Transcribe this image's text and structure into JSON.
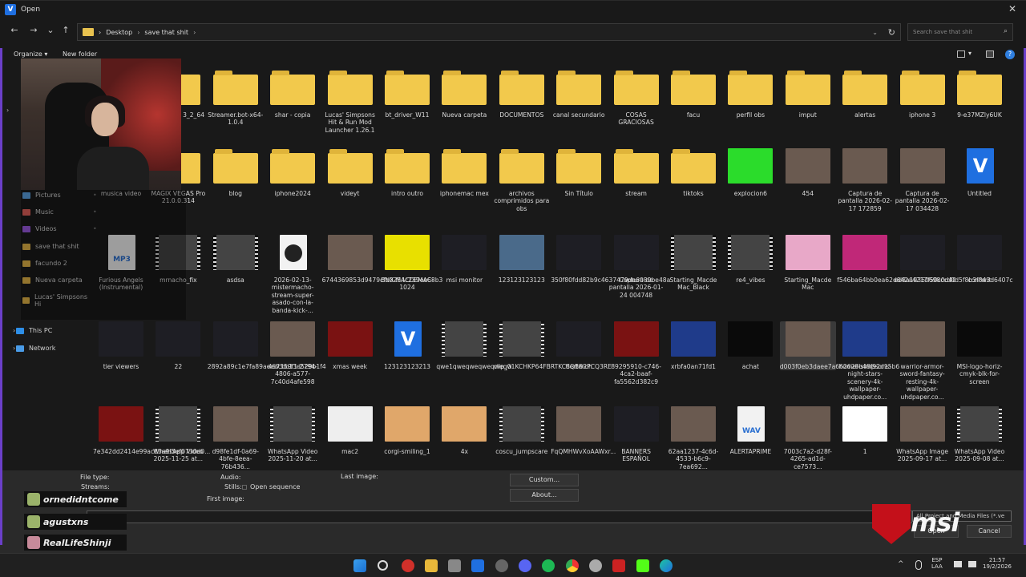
{
  "window": {
    "title": "Open",
    "app_icon": "V",
    "close": "✕"
  },
  "nav": {
    "back": "←",
    "forward": "→",
    "dropdown": "⌄",
    "up": "↑",
    "crumbs": [
      "Desktop",
      "save that shit"
    ],
    "sep": "›",
    "refresh": "↻",
    "addr_dropdown": "⌄",
    "search_placeholder": "Search save that shit",
    "search_icon": "⌕"
  },
  "cmd": {
    "organize": "Organize ▾",
    "new_folder": "New folder",
    "help": "?"
  },
  "sidebar": {
    "items": [
      {
        "label": "Pictures",
        "pin": true
      },
      {
        "label": "Music",
        "pin": true
      },
      {
        "label": "Videos",
        "pin": true
      },
      {
        "label": "save that shit",
        "pin": false
      },
      {
        "label": "facundo 2",
        "pin": false
      },
      {
        "label": "Nueva carpeta",
        "pin": false
      },
      {
        "label": "Lucas' Simpsons Hi",
        "pin": false
      }
    ],
    "this_pc": "This PC",
    "network": "Network"
  },
  "files": [
    {
      "name": "_live_trial 3_2_64",
      "t": "folder"
    },
    {
      "name": "Streamer.bot-x64-1.0.4",
      "t": "folder"
    },
    {
      "name": "shar - copia",
      "t": "folder"
    },
    {
      "name": "Lucas' Simpsons Hit & Run Mod Launcher 1.26.1",
      "t": "folder"
    },
    {
      "name": "bt_driver_W11",
      "t": "folder"
    },
    {
      "name": "Nueva carpeta",
      "t": "folder"
    },
    {
      "name": "DOCUMENTOS",
      "t": "folder"
    },
    {
      "name": "canal secundario",
      "t": "folder"
    },
    {
      "name": "COSAS GRACIOSAS",
      "t": "folder"
    },
    {
      "name": "facu",
      "t": "folder"
    },
    {
      "name": "perfil obs",
      "t": "folder"
    },
    {
      "name": "imput",
      "t": "folder"
    },
    {
      "name": "alertas",
      "t": "folder"
    },
    {
      "name": "iphone 3",
      "t": "folder"
    },
    {
      "name": "9-e37MZly6UK",
      "t": "folder"
    },
    {
      "name": "musica video",
      "t": "folder"
    },
    {
      "name": "MAGIX VEGAS Pro 21.0.0.314",
      "t": "folder"
    },
    {
      "name": "blog",
      "t": "folder"
    },
    {
      "name": "iphone2024",
      "t": "folder"
    },
    {
      "name": "videyt",
      "t": "folder"
    },
    {
      "name": "intro outro",
      "t": "folder"
    },
    {
      "name": "iphonemac mex",
      "t": "folder"
    },
    {
      "name": "archivos comprimidos para obs",
      "t": "folder"
    },
    {
      "name": "Sin Título",
      "t": "folder"
    },
    {
      "name": "stream",
      "t": "folder"
    },
    {
      "name": "tiktoks",
      "t": "folder"
    },
    {
      "name": "explocion6",
      "t": "green"
    },
    {
      "name": "454",
      "t": "photo"
    },
    {
      "name": "Captura de pantalla 2026-02-17 172859",
      "t": "photo"
    },
    {
      "name": "Captura de pantalla 2026-02-17 034428",
      "t": "photo"
    },
    {
      "name": "Untitled",
      "t": "vegas"
    },
    {
      "name": "Furious Angels (Instrumental)",
      "t": "mp3"
    },
    {
      "name": "mrnacho_fix",
      "t": "video"
    },
    {
      "name": "asdsa",
      "t": "video"
    },
    {
      "name": "2026-02-13-mistermacho-stream-super-asado-con-la-banda-kick-...",
      "t": "play"
    },
    {
      "name": "6744369853d9479cfb0254c239ee68b3",
      "t": "photo"
    },
    {
      "name": "BNX-MACDEMAC-1024",
      "t": "qr"
    },
    {
      "name": "msi monitor",
      "t": "dark"
    },
    {
      "name": "123123123123",
      "t": "glitch"
    },
    {
      "name": "350f80fdd82b9c4637479de6080be48a",
      "t": "dark"
    },
    {
      "name": "Captura de pantalla 2026-01-24 004748",
      "t": "dark"
    },
    {
      "name": "Starting_Macde Mac_Black",
      "t": "video"
    },
    {
      "name": "re4_vibes",
      "t": "video"
    },
    {
      "name": "Starting_Macde Mac",
      "t": "pink"
    },
    {
      "name": "f546ba64bb0ea62d842a4217f50c0d40",
      "t": "purple"
    },
    {
      "name": "ed8a19360698ccd0d5f8b3f843d6407c",
      "t": "dark"
    },
    {
      "name": "content",
      "t": "dark"
    },
    {
      "name": "tier viewers",
      "t": "dark"
    },
    {
      "name": "22",
      "t": "dark"
    },
    {
      "name": "2892a89c1e7fa89aeedcbb13d529b1f4",
      "t": "dark"
    },
    {
      "name": "467359f1-2794-4806-a577-7c40d4afe598",
      "t": "photo"
    },
    {
      "name": "xmas week",
      "t": "red"
    },
    {
      "name": "123123123213",
      "t": "vegas"
    },
    {
      "name": "qwe1qweqweqweqweqw",
      "t": "video"
    },
    {
      "name": "clip_01KCHKP64FBRTKC8QBB2PCQ3RE",
      "t": "video"
    },
    {
      "name": "tiertwich",
      "t": "dark"
    },
    {
      "name": "89295910-c746-4ca2-baaf-fa5562d382c9",
      "t": "red"
    },
    {
      "name": "xrbfa0an71fd1",
      "t": "blue"
    },
    {
      "name": "achat",
      "t": "black"
    },
    {
      "name": "d003f0eb3daee7a662628b48f92d15b6",
      "t": "photo",
      "sel": true
    },
    {
      "name": "homer-simpsons-night-stars-scenery-4k-wallpaper-uhdpaper.co...",
      "t": "blue"
    },
    {
      "name": "warrior-armor-sword-fantasy-resting-4k-wallpaper-uhdpaper.co...",
      "t": "photo"
    },
    {
      "name": "MSI-logo-horiz-cmyk-blk-for-screen",
      "t": "black"
    },
    {
      "name": "7e342dd2414e99ac83a9f5ef0730d0...",
      "t": "red"
    },
    {
      "name": "WhatsApp Video 2025-11-25 at...",
      "t": "video"
    },
    {
      "name": "d98fe1df-0a69-4bfe-8eea-76b436...",
      "t": "photo"
    },
    {
      "name": "WhatsApp Video 2025-11-20 at...",
      "t": "video"
    },
    {
      "name": "mac2",
      "t": "manga"
    },
    {
      "name": "corgi-smiling_1",
      "t": "dog"
    },
    {
      "name": "4x",
      "t": "dog"
    },
    {
      "name": "coscu_jumpscare",
      "t": "video"
    },
    {
      "name": "FqQMHWvXoAAWxr...",
      "t": "photo"
    },
    {
      "name": "BANNERS ESPAÑOL",
      "t": "dark"
    },
    {
      "name": "62aa1237-4c6d-4533-b6c9-7ea692...",
      "t": "photo"
    },
    {
      "name": "ALERTAPRIME",
      "t": "wav"
    },
    {
      "name": "7003c7a2-d28f-4265-ad1d-ce7573...",
      "t": "photo"
    },
    {
      "name": "1",
      "t": "doc"
    },
    {
      "name": "WhatsApp Image 2025-09-17 at...",
      "t": "photo"
    },
    {
      "name": "WhatsApp Video 2025-09-08 at...",
      "t": "video"
    }
  ],
  "bottom": {
    "file_type": "File type:",
    "streams": "Streams:",
    "audio": "Audio:",
    "stills": "Stills:",
    "open_sequence": "Open sequence",
    "first_image": "First image:",
    "last_image": "Last image:",
    "custom": "Custom...",
    "about": "About...",
    "filter": "All Project and Media Files (*.ve",
    "open": "Open",
    "cancel": "Cancel",
    "brand": "msi"
  },
  "chat": [
    "ornedidntcome",
    "agustxns",
    "RealLifeShinji"
  ],
  "tray": {
    "lang1": "ESP",
    "lang2": "LAA",
    "time": "21:57",
    "date": "19/2/2026",
    "chev": "^"
  },
  "colors": {
    "accent": "#6b3fc9",
    "folder": "#f2c94c",
    "vegas": "#1f6fe0",
    "msi_red": "#c4101a"
  }
}
